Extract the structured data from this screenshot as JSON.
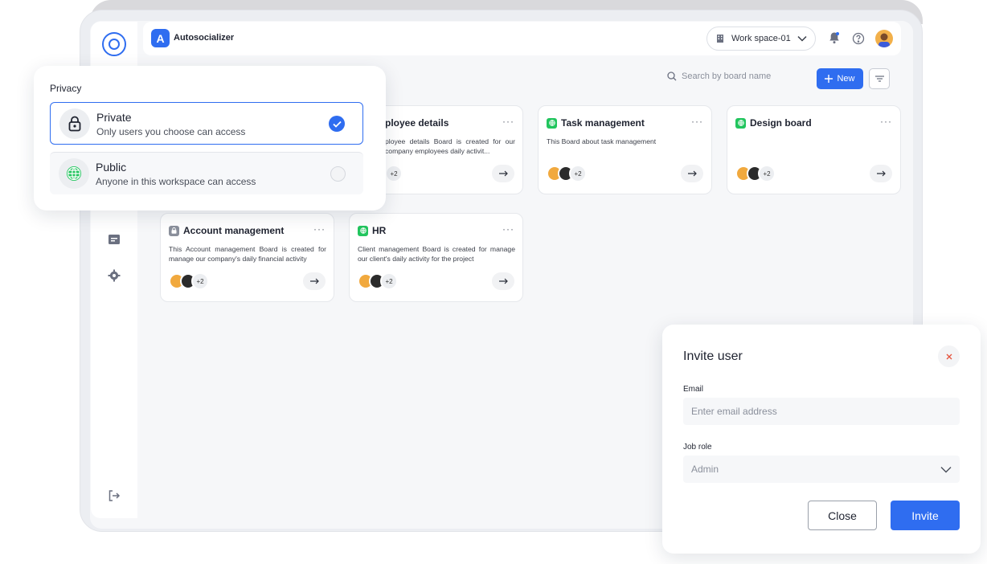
{
  "app": {
    "badge": "A",
    "name": "Autosocializer"
  },
  "header": {
    "workspace": "Work space-01"
  },
  "toolbar": {
    "search_placeholder": "Search by board name",
    "new_label": "New"
  },
  "boards": [
    {
      "title": "ployee details",
      "badge": "none",
      "desc": "ployee details Board is created for our company employees daily activit...",
      "more": "+2",
      "menu": "···"
    },
    {
      "title": "Task management",
      "badge": "green",
      "desc": "This Board about task management",
      "more": "+2",
      "menu": "···"
    },
    {
      "title": "Design board",
      "badge": "green",
      "desc": "",
      "more": "+2",
      "menu": "···"
    },
    {
      "title": "Account management",
      "badge": "gray",
      "desc": "This Account management Board is created for manage our company's daily financial activity",
      "more": "+2",
      "menu": "···"
    },
    {
      "title": "HR",
      "badge": "green",
      "desc": "Client management Board is created for manage our client's daily activity for the project",
      "more": "+2",
      "menu": "···"
    }
  ],
  "privacy": {
    "title": "Privacy",
    "options": [
      {
        "title": "Private",
        "subtitle": "Only users you choose can access",
        "selected": true
      },
      {
        "title": "Public",
        "subtitle": "Anyone in this workspace can access",
        "selected": false
      }
    ]
  },
  "invite": {
    "title": "Invite user",
    "email_label": "Email",
    "email_placeholder": "Enter email address",
    "role_label": "Job role",
    "role_value": "Admin",
    "close_label": "Close",
    "invite_label": "Invite"
  },
  "colors": {
    "primary": "#2f6df0",
    "success": "#22c55e"
  }
}
